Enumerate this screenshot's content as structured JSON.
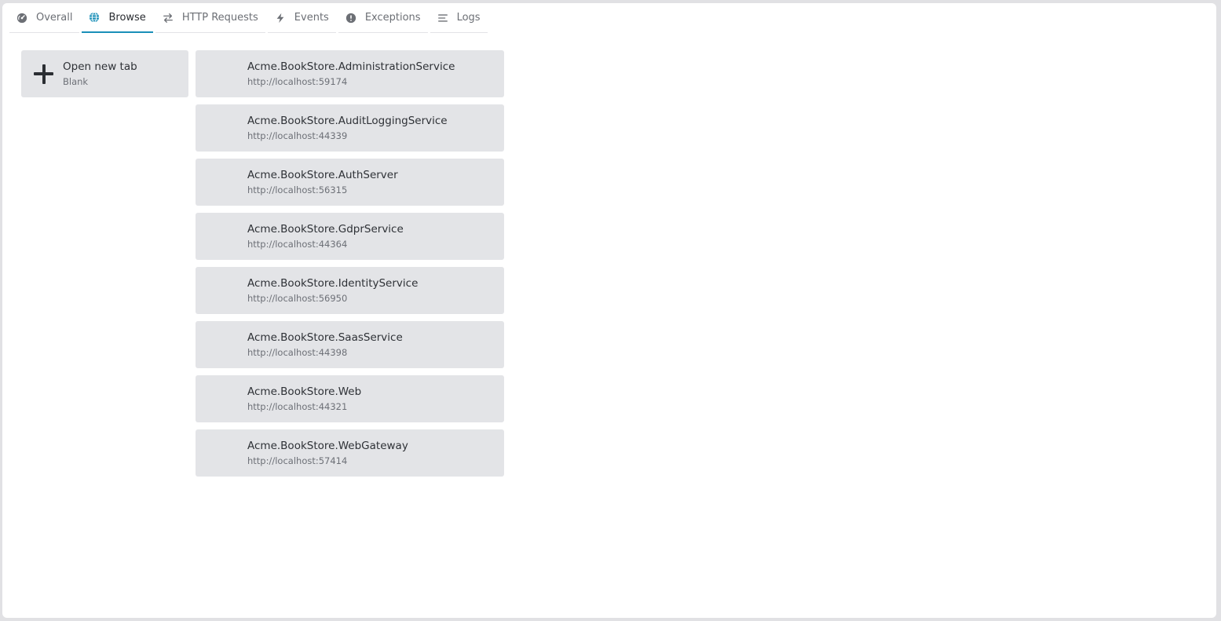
{
  "tabs": [
    {
      "label": "Overall",
      "icon": "dashboard-icon",
      "active": false
    },
    {
      "label": "Browse",
      "icon": "globe-icon",
      "active": true
    },
    {
      "label": "HTTP Requests",
      "icon": "arrows-exchange-icon",
      "active": false
    },
    {
      "label": "Events",
      "icon": "lightning-icon",
      "active": false
    },
    {
      "label": "Exceptions",
      "icon": "exclamation-circle-icon",
      "active": false
    },
    {
      "label": "Logs",
      "icon": "lines-icon",
      "active": false
    }
  ],
  "new_tab": {
    "title": "Open new tab",
    "subtitle": "Blank",
    "icon": "plus-icon"
  },
  "services": [
    {
      "name": "Acme.BookStore.AdministrationService",
      "url": "http://localhost:59174"
    },
    {
      "name": "Acme.BookStore.AuditLoggingService",
      "url": "http://localhost:44339"
    },
    {
      "name": "Acme.BookStore.AuthServer",
      "url": "http://localhost:56315"
    },
    {
      "name": "Acme.BookStore.GdprService",
      "url": "http://localhost:44364"
    },
    {
      "name": "Acme.BookStore.IdentityService",
      "url": "http://localhost:56950"
    },
    {
      "name": "Acme.BookStore.SaasService",
      "url": "http://localhost:44398"
    },
    {
      "name": "Acme.BookStore.Web",
      "url": "http://localhost:44321"
    },
    {
      "name": "Acme.BookStore.WebGateway",
      "url": "http://localhost:57414"
    }
  ],
  "colors": {
    "accent": "#1a8fb8",
    "card_bg": "#e3e4e7",
    "text": "#2e3136",
    "muted": "#6d7077"
  }
}
